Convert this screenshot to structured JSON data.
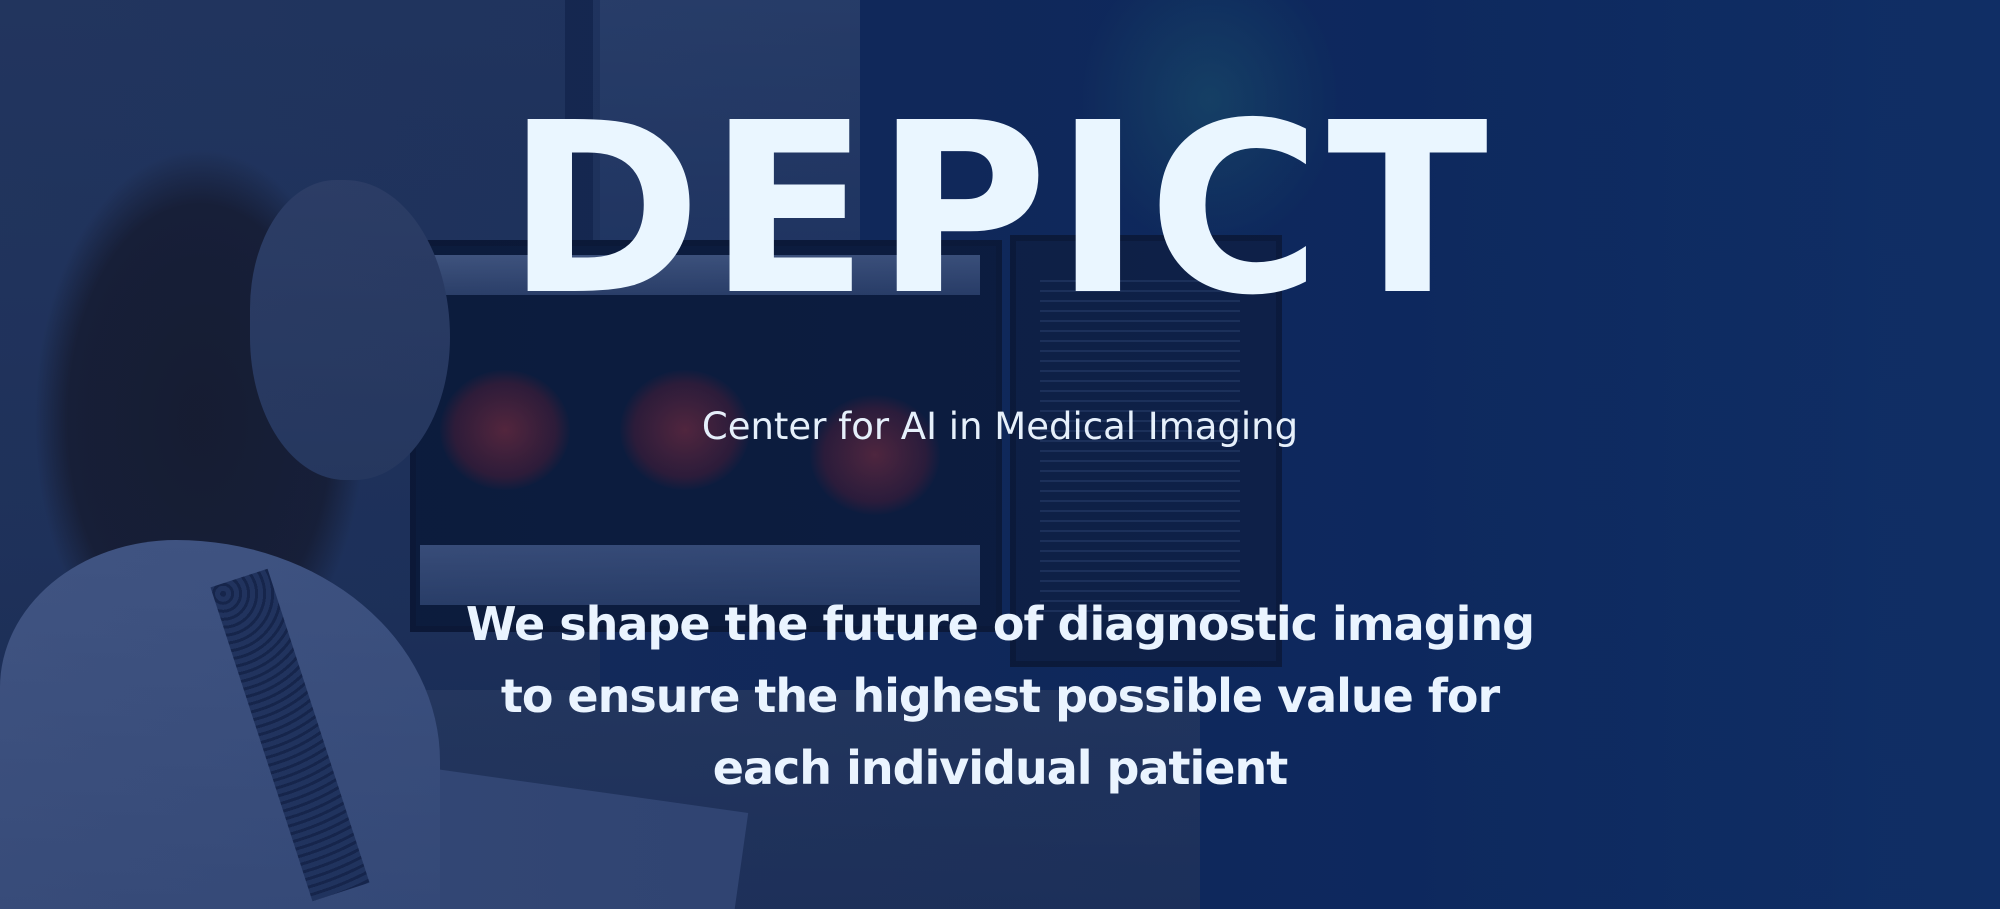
{
  "hero": {
    "title": "DEPICT",
    "subtitle": "Center for AI in Medical Imaging",
    "mission_lines": [
      "We shape the future of diagnostic imaging",
      "to ensure the highest possible value for",
      "each individual patient"
    ]
  },
  "colors": {
    "overlay": "#0f2a5c",
    "text": "#eaf6ff"
  }
}
